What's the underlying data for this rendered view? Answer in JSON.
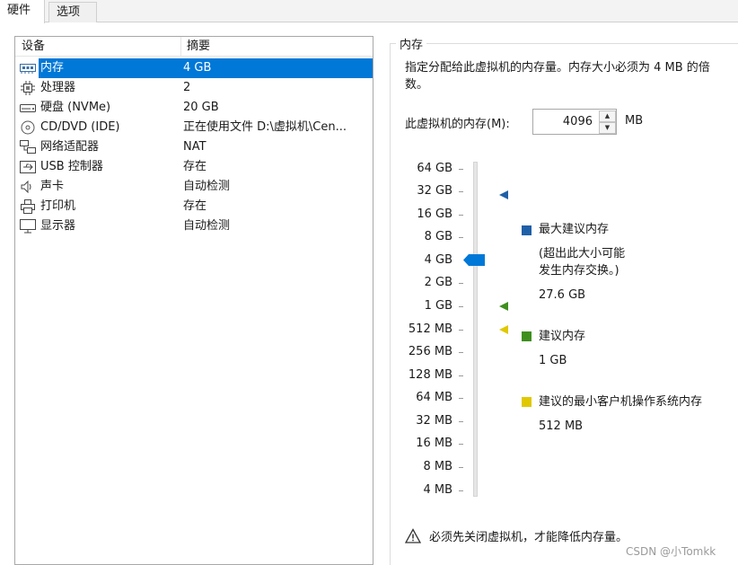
{
  "tabs": [
    {
      "label": "硬件"
    },
    {
      "label": "选项"
    }
  ],
  "devices": {
    "headers": {
      "device": "设备",
      "summary": "摘要"
    },
    "rows": [
      {
        "name": "内存",
        "value": "4 GB",
        "icon": "memory-icon",
        "selected": true
      },
      {
        "name": "处理器",
        "value": "2",
        "icon": "cpu-icon"
      },
      {
        "name": "硬盘 (NVMe)",
        "value": "20 GB",
        "icon": "disk-icon"
      },
      {
        "name": "CD/DVD (IDE)",
        "value": "正在使用文件 D:\\虚拟机\\Cen...",
        "icon": "cd-icon"
      },
      {
        "name": "网络适配器",
        "value": "NAT",
        "icon": "network-icon"
      },
      {
        "name": "USB 控制器",
        "value": "存在",
        "icon": "usb-icon"
      },
      {
        "name": "声卡",
        "value": "自动检测",
        "icon": "speaker-icon"
      },
      {
        "name": "打印机",
        "value": "存在",
        "icon": "printer-icon"
      },
      {
        "name": "显示器",
        "value": "自动检测",
        "icon": "monitor-icon"
      }
    ]
  },
  "memory": {
    "group_title": "内存",
    "description": "指定分配给此虚拟机的内存量。内存大小必须为 4 MB 的倍数。",
    "field_label": "此虚拟机的内存(M):",
    "value": "4096",
    "unit": "MB",
    "scale": [
      "64 GB",
      "32 GB",
      "16 GB",
      "8 GB",
      "4 GB",
      "2 GB",
      "1 GB",
      "512 MB",
      "256 MB",
      "128 MB",
      "64 MB",
      "32 MB",
      "16 MB",
      "8 MB",
      "4 MB"
    ],
    "legend": {
      "max": {
        "label": "最大建议内存",
        "note_line1": "(超出此大小可能",
        "note_line2": "发生内存交换。)",
        "value": "27.6 GB",
        "color": "#1f5fa8"
      },
      "recommended": {
        "label": "建议内存",
        "value": "1 GB",
        "color": "#3f8f1e"
      },
      "min_guest": {
        "label": "建议的最小客户机操作系统内存",
        "value": "512 MB",
        "color": "#e0c800"
      }
    },
    "warning": "必须先关闭虚拟机，才能降低内存量。"
  },
  "watermark": "CSDN @小Tomkk",
  "colors": {
    "selection": "#0078d7",
    "thumb": "#0078d7"
  }
}
